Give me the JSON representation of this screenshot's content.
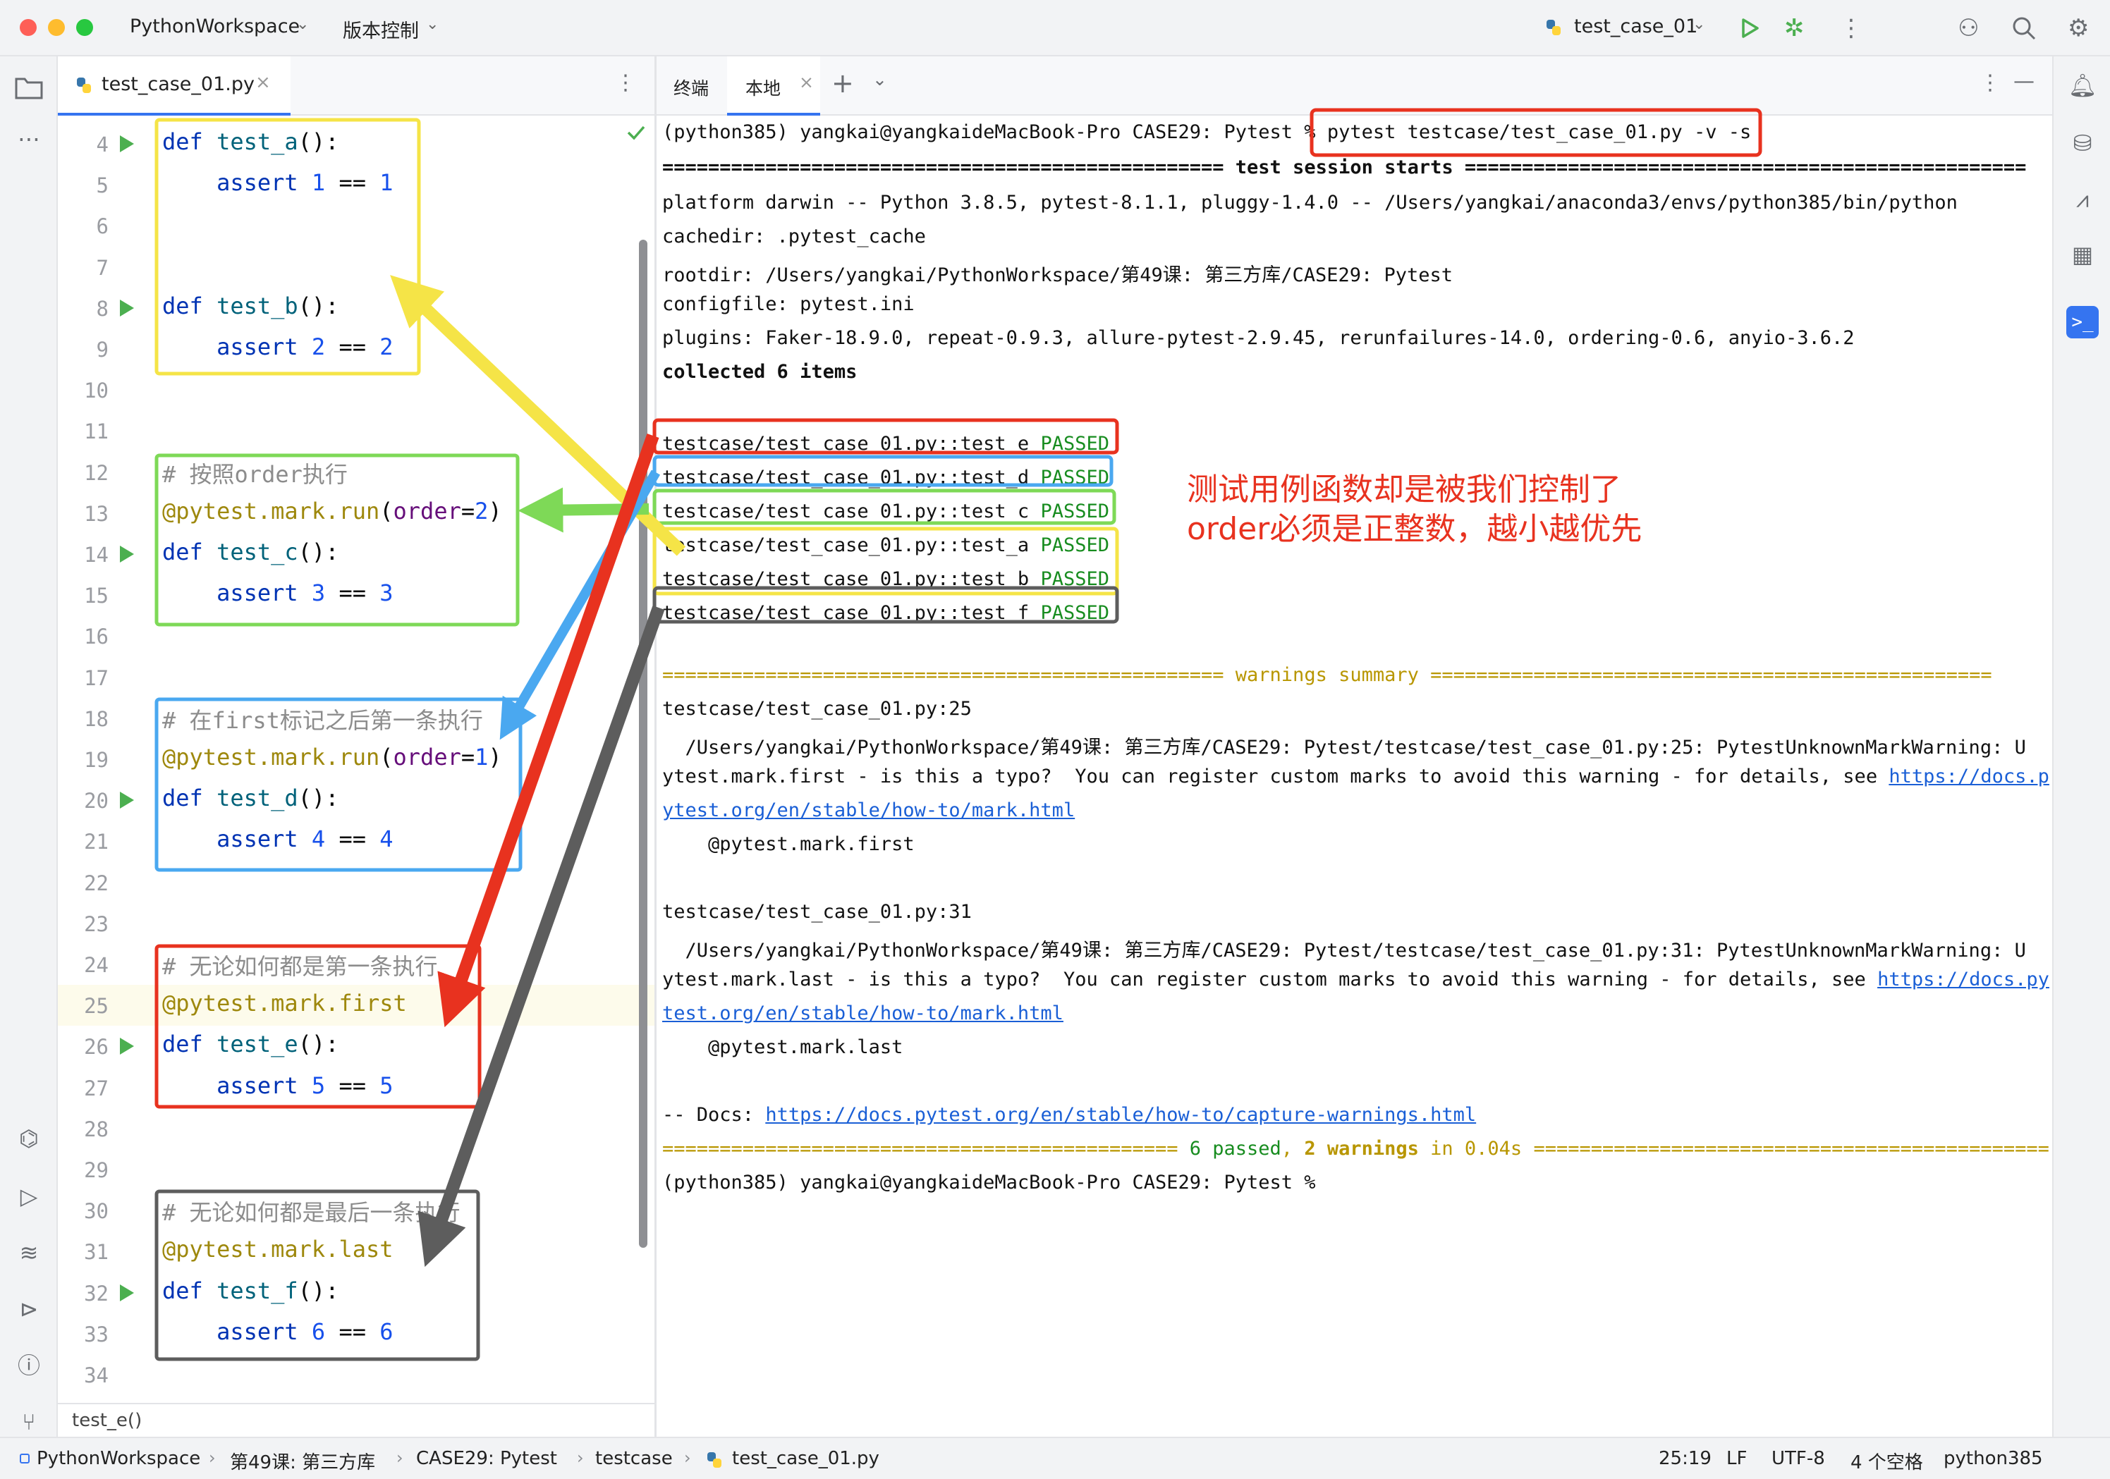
{
  "titlebar": {
    "project": "PythonWorkspace",
    "vcs": "版本控制",
    "run_config": "test_case_01"
  },
  "editor": {
    "tab_label": "test_case_01.py",
    "lines": [
      {
        "n": "4",
        "run": true,
        "code": [
          [
            "kw",
            "def "
          ],
          [
            "fn",
            "test_a"
          ],
          [
            "p",
            "():"
          ]
        ]
      },
      {
        "n": "5",
        "run": false,
        "code": [
          [
            "kw",
            "    assert "
          ],
          [
            "num",
            "1"
          ],
          [
            "p",
            " == "
          ],
          [
            "num",
            "1"
          ]
        ]
      },
      {
        "n": "6",
        "run": false,
        "code": []
      },
      {
        "n": "7",
        "run": false,
        "code": []
      },
      {
        "n": "8",
        "run": true,
        "code": [
          [
            "kw",
            "def "
          ],
          [
            "fn",
            "test_b"
          ],
          [
            "p",
            "():"
          ]
        ]
      },
      {
        "n": "9",
        "run": false,
        "code": [
          [
            "kw",
            "    assert "
          ],
          [
            "num",
            "2"
          ],
          [
            "p",
            " == "
          ],
          [
            "num",
            "2"
          ]
        ]
      },
      {
        "n": "10",
        "run": false,
        "code": []
      },
      {
        "n": "11",
        "run": false,
        "code": []
      },
      {
        "n": "12",
        "run": false,
        "code": [
          [
            "cm",
            "# 按照order执行"
          ]
        ]
      },
      {
        "n": "13",
        "run": false,
        "code": [
          [
            "dec",
            "@pytest.mark.run"
          ],
          [
            "p",
            "("
          ],
          [
            "arg",
            "order"
          ],
          [
            "p",
            "="
          ],
          [
            "num",
            "2"
          ],
          [
            "p",
            ")"
          ]
        ]
      },
      {
        "n": "14",
        "run": true,
        "code": [
          [
            "kw",
            "def "
          ],
          [
            "fn",
            "test_c"
          ],
          [
            "p",
            "():"
          ]
        ]
      },
      {
        "n": "15",
        "run": false,
        "code": [
          [
            "kw",
            "    assert "
          ],
          [
            "num",
            "3"
          ],
          [
            "p",
            " == "
          ],
          [
            "num",
            "3"
          ]
        ]
      },
      {
        "n": "16",
        "run": false,
        "code": []
      },
      {
        "n": "17",
        "run": false,
        "code": []
      },
      {
        "n": "18",
        "run": false,
        "code": [
          [
            "cm",
            "# 在first标记之后第一条执行"
          ]
        ]
      },
      {
        "n": "19",
        "run": false,
        "code": [
          [
            "dec",
            "@pytest.mark.run"
          ],
          [
            "p",
            "("
          ],
          [
            "arg",
            "order"
          ],
          [
            "p",
            "="
          ],
          [
            "num",
            "1"
          ],
          [
            "p",
            ")"
          ]
        ]
      },
      {
        "n": "20",
        "run": true,
        "code": [
          [
            "kw",
            "def "
          ],
          [
            "fn",
            "test_d"
          ],
          [
            "p",
            "():"
          ]
        ]
      },
      {
        "n": "21",
        "run": false,
        "code": [
          [
            "kw",
            "    assert "
          ],
          [
            "num",
            "4"
          ],
          [
            "p",
            " == "
          ],
          [
            "num",
            "4"
          ]
        ]
      },
      {
        "n": "22",
        "run": false,
        "code": []
      },
      {
        "n": "23",
        "run": false,
        "code": []
      },
      {
        "n": "24",
        "run": false,
        "code": [
          [
            "cm",
            "# 无论如何都是第一条执行"
          ]
        ]
      },
      {
        "n": "25",
        "run": false,
        "code": [
          [
            "dec",
            "@pytest.mark.first"
          ]
        ]
      },
      {
        "n": "26",
        "run": true,
        "code": [
          [
            "kw",
            "def "
          ],
          [
            "fn",
            "test_e"
          ],
          [
            "p",
            "():"
          ]
        ]
      },
      {
        "n": "27",
        "run": false,
        "code": [
          [
            "kw",
            "    assert "
          ],
          [
            "num",
            "5"
          ],
          [
            "p",
            " == "
          ],
          [
            "num",
            "5"
          ]
        ]
      },
      {
        "n": "28",
        "run": false,
        "code": []
      },
      {
        "n": "29",
        "run": false,
        "code": []
      },
      {
        "n": "30",
        "run": false,
        "code": [
          [
            "cm",
            "# 无论如何都是最后一条执行"
          ]
        ]
      },
      {
        "n": "31",
        "run": false,
        "code": [
          [
            "dec",
            "@pytest.mark.last"
          ]
        ]
      },
      {
        "n": "32",
        "run": true,
        "code": [
          [
            "kw",
            "def "
          ],
          [
            "fn",
            "test_f"
          ],
          [
            "p",
            "():"
          ]
        ]
      },
      {
        "n": "33",
        "run": false,
        "code": [
          [
            "kw",
            "    assert "
          ],
          [
            "num",
            "6"
          ],
          [
            "p",
            " == "
          ],
          [
            "num",
            "6"
          ]
        ]
      },
      {
        "n": "34",
        "run": false,
        "code": []
      }
    ],
    "footer": "test_e()"
  },
  "terminal": {
    "tab_terminal": "终端",
    "tab_local": "本地",
    "prompt": "(python385) yangkai@yangkaideMacBook-Pro CASE29: Pytest % ",
    "command": "pytest testcase/test_case_01.py -v -s",
    "session_line_left": "================================================= ",
    "session_title": "test session starts",
    "session_line_right": " =================================================",
    "info": [
      "platform darwin -- Python 3.8.5, pytest-8.1.1, pluggy-1.4.0 -- /Users/yangkai/anaconda3/envs/python385/bin/python",
      "cachedir: .pytest_cache",
      "rootdir: /Users/yangkai/PythonWorkspace/第49课: 第三方库/CASE29: Pytest",
      "configfile: pytest.ini",
      "plugins: Faker-18.9.0, repeat-0.9.3, allure-pytest-2.9.45, rerunfailures-14.0, ordering-0.6, anyio-3.6.2"
    ],
    "collected": "collected 6 items",
    "results": [
      {
        "test": "testcase/test_case_01.py::test_e ",
        "status": "PASSED"
      },
      {
        "test": "testcase/test_case_01.py::test_d ",
        "status": "PASSED"
      },
      {
        "test": "testcase/test_case_01.py::test_c ",
        "status": "PASSED"
      },
      {
        "test": "testcase/test_case_01.py::test_a ",
        "status": "PASSED"
      },
      {
        "test": "testcase/test_case_01.py::test_b ",
        "status": "PASSED"
      },
      {
        "test": "testcase/test_case_01.py::test_f ",
        "status": "PASSED"
      }
    ],
    "warnings_left": "================================================= ",
    "warnings_title": "warnings summary",
    "warnings_right": " =================================================",
    "w1_loc": "testcase/test_case_01.py:25",
    "w1_path": "  /Users/yangkai/PythonWorkspace/第49课: 第三方库/CASE29: Pytest/testcase/test_case_01.py:25: PytestUnknownMarkWarning: U",
    "w1_text": "ytest.mark.first - is this a typo?  You can register custom marks to avoid this warning - for details, see ",
    "w1_link_a": "https://docs.p",
    "w1_link_b": "ytest.org/en/stable/how-to/mark.html",
    "w1_mark": "    @pytest.mark.first",
    "w2_loc": "testcase/test_case_01.py:31",
    "w2_path": "  /Users/yangkai/PythonWorkspace/第49课: 第三方库/CASE29: Pytest/testcase/test_case_01.py:31: PytestUnknownMarkWarning: U",
    "w2_text": "ytest.mark.last - is this a typo?  You can register custom marks to avoid this warning - for details, see ",
    "w2_link_a": "https://docs.py",
    "w2_link_b": "test.org/en/stable/how-to/mark.html",
    "w2_mark": "    @pytest.mark.last",
    "docs_prefix": "-- Docs: ",
    "docs_link": "https://docs.pytest.org/en/stable/how-to/capture-warnings.html",
    "summary_left": "============================================= ",
    "summary_passed": "6 passed",
    "summary_comma": ", ",
    "summary_warnings": "2 warnings",
    "summary_time": " in 0.04s",
    "summary_right": " =============================================",
    "final_prompt": "(python385) yangkai@yangkaideMacBook-Pro CASE29: Pytest %",
    "annotation_1": "测试用例函数却是被我们控制了",
    "annotation_2": "order必须是正整数，越小越优先"
  },
  "statusbar": {
    "breadcrumbs": [
      "PythonWorkspace",
      "第49课: 第三方库",
      "CASE29: Pytest",
      "testcase",
      "test_case_01.py"
    ],
    "position": "25:19",
    "line_sep": "LF",
    "encoding": "UTF-8",
    "indent": "4 个空格",
    "interpreter": "python385"
  },
  "colors": {
    "yellow_box": "#f5e447",
    "green_box": "#7ed957",
    "blue_box": "#4aa8f0",
    "red_box": "#e8321f",
    "gray_box": "#5d5d5d",
    "accent": "#3574f0"
  }
}
